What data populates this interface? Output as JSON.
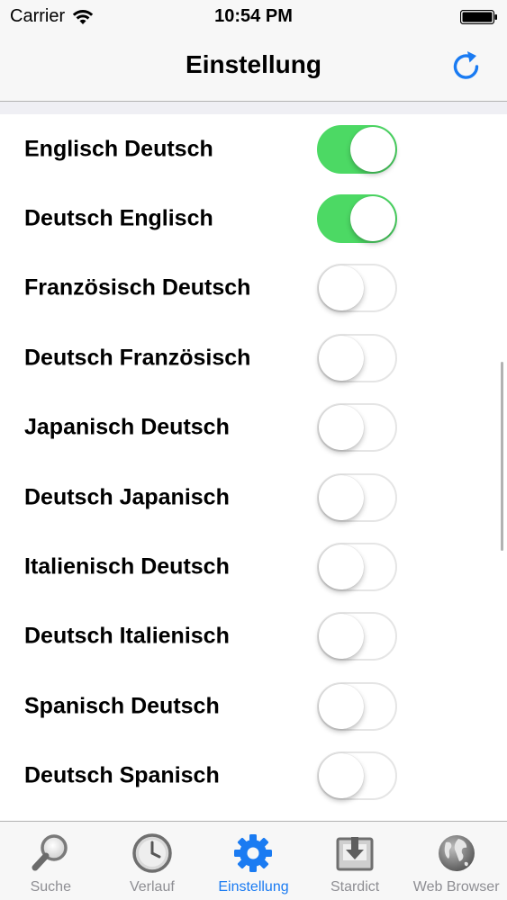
{
  "status_bar": {
    "carrier": "Carrier",
    "time": "10:54 PM"
  },
  "nav": {
    "title": "Einstellung",
    "refresh_icon": "refresh-icon"
  },
  "settings": [
    {
      "label": "Englisch Deutsch",
      "enabled": true
    },
    {
      "label": "Deutsch Englisch",
      "enabled": true
    },
    {
      "label": "Französisch Deutsch",
      "enabled": false
    },
    {
      "label": "Deutsch Französisch",
      "enabled": false
    },
    {
      "label": "Japanisch Deutsch",
      "enabled": false
    },
    {
      "label": "Deutsch Japanisch",
      "enabled": false
    },
    {
      "label": "Italienisch Deutsch",
      "enabled": false
    },
    {
      "label": "Deutsch Italienisch",
      "enabled": false
    },
    {
      "label": "Spanisch Deutsch",
      "enabled": false
    },
    {
      "label": "Deutsch Spanisch",
      "enabled": false
    }
  ],
  "tabs": [
    {
      "label": "Suche",
      "icon": "search-icon",
      "active": false
    },
    {
      "label": "Verlauf",
      "icon": "clock-icon",
      "active": false
    },
    {
      "label": "Einstellung",
      "icon": "gear-icon",
      "active": true
    },
    {
      "label": "Stardict",
      "icon": "download-icon",
      "active": false
    },
    {
      "label": "Web Browser",
      "icon": "globe-icon",
      "active": false
    }
  ],
  "colors": {
    "accent": "#1a7bf2",
    "switch_on": "#4cd964",
    "tab_inactive": "#8e8e93"
  }
}
